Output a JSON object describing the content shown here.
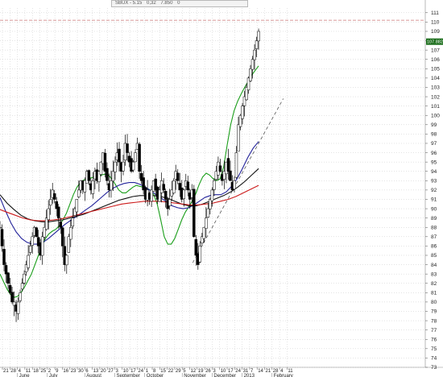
{
  "header": {
    "symbol": "SBUX - 5.15",
    "field1": "0,32",
    "field2": "7.850",
    "field3": "0"
  },
  "chart_data": {
    "type": "candlestick",
    "title": "",
    "last_price_label": "107.8820",
    "ylim": [
      73,
      111.5
    ],
    "y_ticks": [
      73,
      74,
      75,
      76,
      77,
      78,
      79,
      80,
      81,
      82,
      83,
      84,
      85,
      86,
      87,
      88,
      89,
      90,
      91,
      92,
      93,
      94,
      95,
      96,
      97,
      98,
      99,
      100,
      101,
      102,
      103,
      104,
      105,
      106,
      107,
      108,
      109,
      110,
      111
    ],
    "date_ticks": [
      "21",
      "28",
      "4",
      "11",
      "18",
      "25",
      "2",
      "9",
      "16",
      "23",
      "30",
      "6",
      "13",
      "20",
      "27",
      "3",
      "10",
      "17",
      "24",
      "1",
      "8",
      "15",
      "22",
      "29",
      "5",
      "12",
      "19",
      "26",
      "3",
      "10",
      "17",
      "24",
      "31",
      "7",
      "14",
      "21",
      "28",
      "4",
      "11"
    ],
    "months": [
      {
        "label": "June",
        "index": 2
      },
      {
        "label": "July",
        "index": 6
      },
      {
        "label": "August",
        "index": 11
      },
      {
        "label": "September",
        "index": 15
      },
      {
        "label": "October",
        "index": 19
      },
      {
        "label": "November",
        "index": 24
      },
      {
        "label": "December",
        "index": 28
      },
      {
        "label": "2013",
        "index": 32
      },
      {
        "label": "February",
        "index": 36
      }
    ],
    "last_bar_index": 34.2,
    "candle_closes": [
      88,
      86,
      84,
      83,
      82,
      81,
      80,
      80,
      79,
      80,
      81,
      82,
      83,
      84,
      85,
      86,
      87,
      88,
      87,
      86,
      85,
      87,
      88,
      89,
      90,
      91,
      92,
      91,
      90,
      89,
      88,
      86,
      84,
      85,
      87,
      88,
      89,
      90,
      91,
      92,
      93,
      92,
      93,
      94,
      93,
      92,
      93,
      94,
      93,
      94,
      95,
      96,
      94,
      93,
      92,
      93,
      94,
      95,
      96,
      95,
      94,
      95,
      97,
      96,
      95,
      94,
      95,
      96,
      97,
      94,
      93,
      92,
      91,
      92,
      91,
      92,
      93,
      92,
      91,
      92,
      93,
      92,
      91,
      90,
      91,
      92,
      93,
      94,
      93,
      92,
      91,
      92,
      93,
      92,
      91,
      92,
      87,
      85,
      84,
      86,
      87,
      88,
      89,
      90,
      91,
      92,
      93,
      94,
      95,
      94,
      93,
      94,
      95,
      94,
      93,
      92,
      93,
      96,
      99,
      100,
      101,
      102,
      103,
      104,
      105,
      106,
      107,
      108,
      109
    ],
    "series": [
      {
        "name": "",
        "color": "#1a9e1a",
        "values": [
          83,
          82.2,
          81.4,
          80.8,
          80.5,
          80.6,
          81,
          81.6,
          82.3,
          83,
          84,
          85,
          86,
          86.8,
          87.3,
          87.6,
          87.8,
          88.2,
          88.8,
          89.5,
          90.5,
          91.5,
          92.3,
          92.8,
          93.1,
          93.2,
          93.3,
          93.4,
          93.5,
          93.6,
          93.7,
          93.6,
          93.2,
          92.6,
          92,
          91.7,
          91.7,
          92,
          92.3,
          92.5,
          92.4,
          92.3,
          92.2,
          92,
          91.5,
          90.5,
          88.8,
          87,
          86.2,
          86.2,
          86.8,
          87.8,
          88.8,
          89.6,
          90.2,
          90.8,
          91.6,
          92.6,
          93.4,
          93.8,
          93.6,
          93.2,
          93,
          93.2,
          94.5,
          96.8,
          99,
          100.5,
          101.5,
          102.3,
          103,
          103.6,
          104.3,
          104.8,
          105.3
        ]
      },
      {
        "name": "",
        "color": "#22229a",
        "values": [
          91.2,
          89.8,
          88.5,
          87.5,
          86.8,
          86.4,
          86.2,
          86.2,
          86.4,
          86.8,
          87.3,
          87.8,
          88.3,
          88.7,
          89.1,
          89.5,
          89.9,
          90.3,
          90.8,
          91.3,
          91.8,
          92.2,
          92.5,
          92.7,
          92.8,
          92.8,
          92.6,
          92.3,
          91.9,
          91.5,
          91.1,
          90.7,
          90.3,
          90.1,
          90,
          90.1,
          90.4,
          90.8,
          91.2,
          91.4,
          91.5,
          91.5,
          91.8,
          92.4,
          93.2,
          94.3,
          95.5,
          96.5,
          97.2
        ]
      },
      {
        "name": "",
        "color": "#111111",
        "values": [
          91.5,
          90.6,
          89.9,
          89.3,
          88.9,
          88.7,
          88.6,
          88.6,
          88.7,
          88.8,
          89,
          89.2,
          89.4,
          89.7,
          90,
          90.3,
          90.6,
          90.9,
          91.1,
          91.3,
          91.4,
          91.4,
          91.4,
          91.3,
          91.1,
          90.8,
          90.5,
          90.3,
          90.3,
          90.5,
          90.8,
          91.1,
          91.4,
          91.8,
          92.3,
          92.9,
          93.6,
          94.3
        ]
      },
      {
        "name": "",
        "color": "#cc1a1a",
        "values": [
          89.9,
          89.6,
          89.3,
          89,
          88.8,
          88.7,
          88.7,
          88.8,
          88.9,
          89.1,
          89.3,
          89.5,
          89.7,
          89.9,
          90.1,
          90.3,
          90.5,
          90.6,
          90.7,
          90.8,
          90.8,
          90.8,
          90.7,
          90.6,
          90.5,
          90.4,
          90.4,
          90.5,
          90.6,
          90.8,
          91,
          91.3,
          91.7,
          92.1,
          92.5
        ]
      },
      {
        "name": "",
        "color": "#cc7777",
        "values": [
          110.2,
          110.2
        ]
      }
    ],
    "trendline": {
      "from": [
        25.4,
        84.2
      ],
      "to": [
        37.5,
        101.8
      ]
    }
  }
}
